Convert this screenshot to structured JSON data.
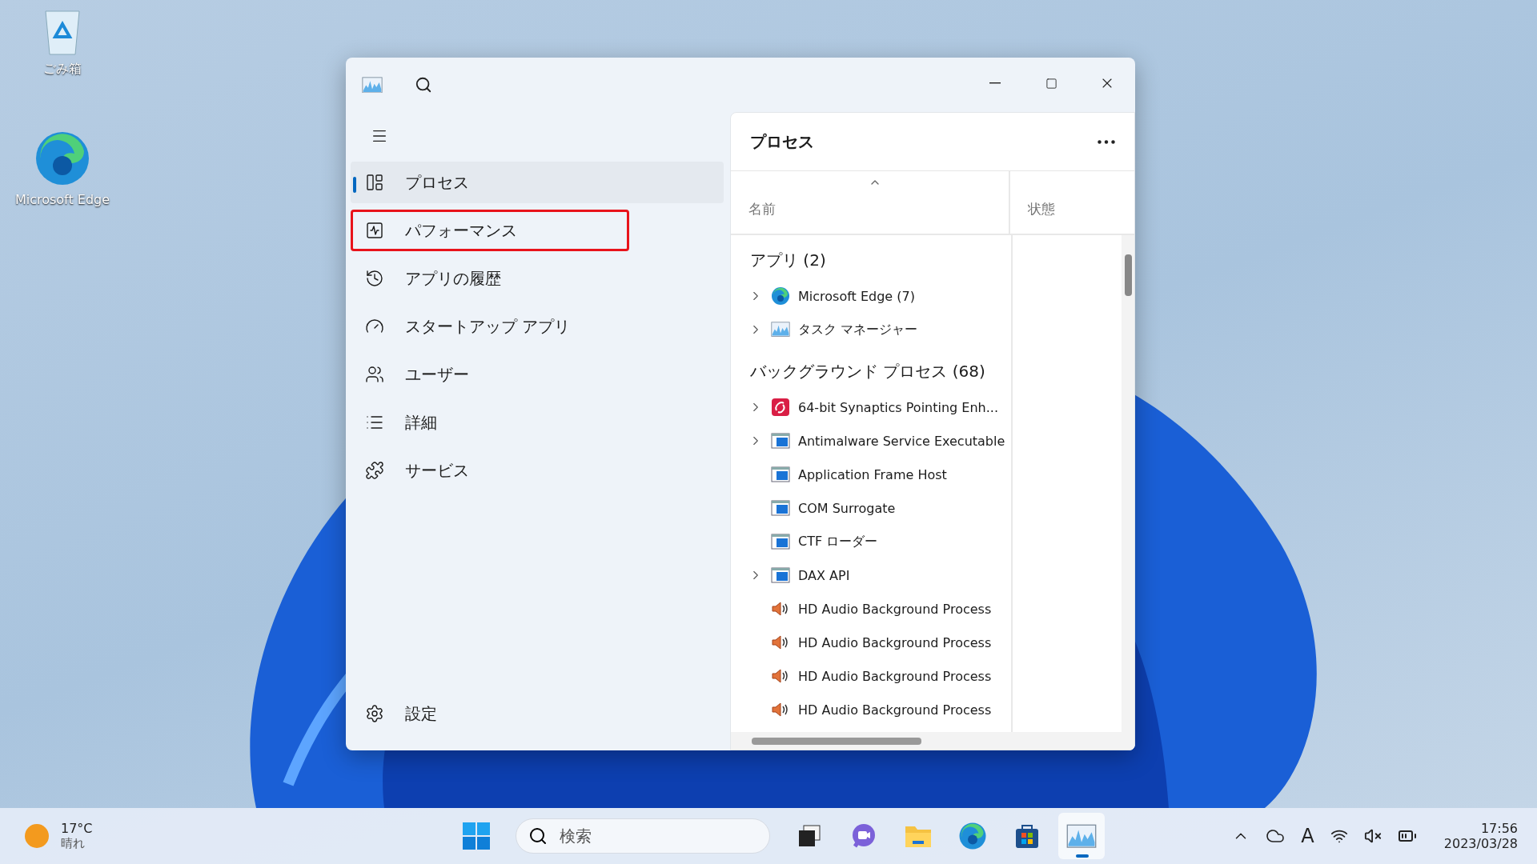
{
  "desktop_icons": [
    {
      "label": "ごみ箱",
      "kind": "recycle"
    },
    {
      "label": "Microsoft Edge",
      "kind": "edge"
    }
  ],
  "window": {
    "sidebar": {
      "items": [
        {
          "label": "プロセス",
          "selected": true,
          "outlined": false
        },
        {
          "label": "パフォーマンス",
          "selected": false,
          "outlined": true
        },
        {
          "label": "アプリの履歴",
          "selected": false,
          "outlined": false
        },
        {
          "label": "スタートアップ アプリ",
          "selected": false,
          "outlined": false
        },
        {
          "label": "ユーザー",
          "selected": false,
          "outlined": false
        },
        {
          "label": "詳細",
          "selected": false,
          "outlined": false
        },
        {
          "label": "サービス",
          "selected": false,
          "outlined": false
        }
      ],
      "settings": "設定"
    },
    "panel": {
      "title": "プロセス",
      "columns": [
        "名前",
        "状態"
      ],
      "groups": [
        {
          "title": "アプリ (2)",
          "rows": [
            {
              "name": "Microsoft Edge (7)",
              "kind": "edge",
              "expandable": true
            },
            {
              "name": "タスク マネージャー",
              "kind": "taskmgr",
              "expandable": true
            }
          ]
        },
        {
          "title": "バックグラウンド プロセス (68)",
          "rows": [
            {
              "name": "64-bit Synaptics Pointing Enh...",
              "kind": "synaptics",
              "expandable": true
            },
            {
              "name": "Antimalware Service Executable",
              "kind": "window",
              "expandable": true
            },
            {
              "name": "Application Frame Host",
              "kind": "window",
              "expandable": false
            },
            {
              "name": "COM Surrogate",
              "kind": "window",
              "expandable": false
            },
            {
              "name": "CTF ローダー",
              "kind": "window",
              "expandable": false
            },
            {
              "name": "DAX API",
              "kind": "window",
              "expandable": true
            },
            {
              "name": "HD Audio Background Process",
              "kind": "speaker",
              "expandable": false
            },
            {
              "name": "HD Audio Background Process",
              "kind": "speaker",
              "expandable": false
            },
            {
              "name": "HD Audio Background Process",
              "kind": "speaker",
              "expandable": false
            },
            {
              "name": "HD Audio Background Process",
              "kind": "speaker",
              "expandable": false
            }
          ]
        }
      ]
    }
  },
  "taskbar": {
    "weather": {
      "temp": "17°C",
      "condition": "晴れ"
    },
    "search": {
      "placeholder": "検索"
    },
    "apps": [
      {
        "kind": "taskview",
        "active": false
      },
      {
        "kind": "chat",
        "active": false
      },
      {
        "kind": "folder",
        "active": false
      },
      {
        "kind": "edge",
        "active": false
      },
      {
        "kind": "store",
        "active": false
      },
      {
        "kind": "taskmgr",
        "active": true
      }
    ],
    "ime": "A",
    "time": "17:56",
    "date": "2023/03/28"
  }
}
